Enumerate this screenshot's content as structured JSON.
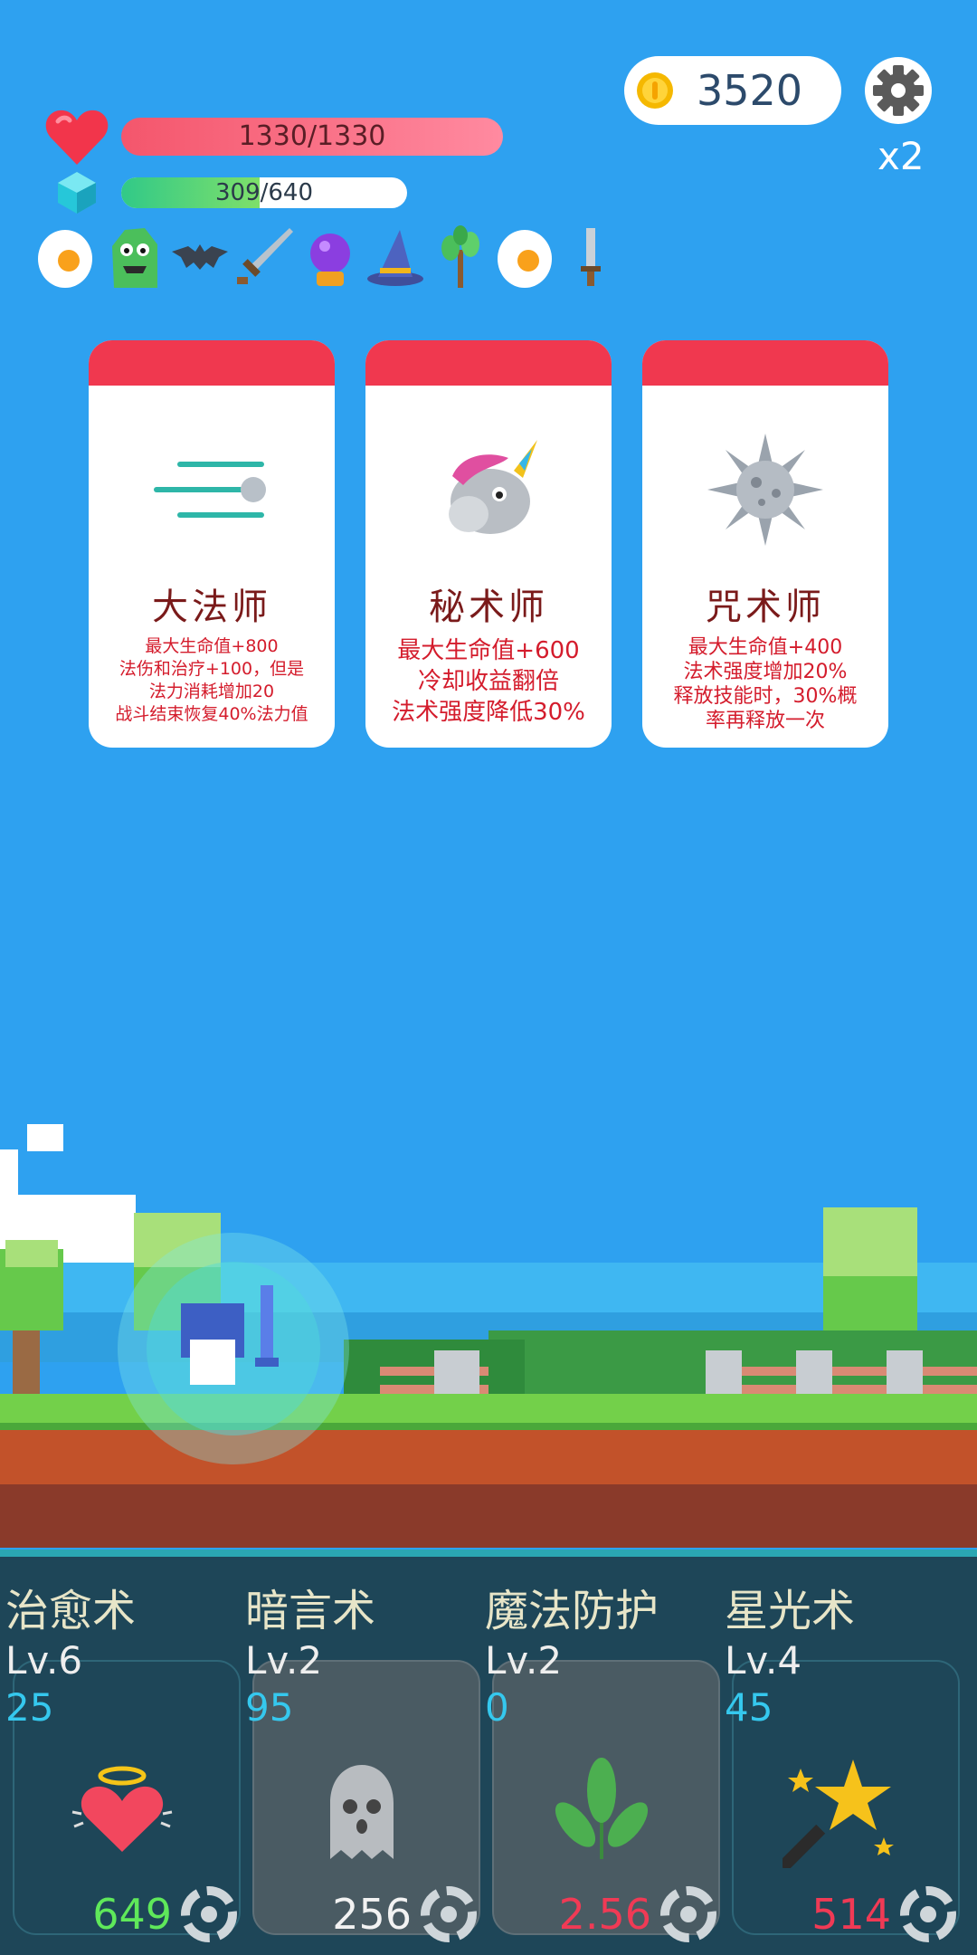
{
  "hud": {
    "coins": "3520",
    "speed": "x2",
    "hp": {
      "text": "1330/1330",
      "current": 1330,
      "max": 1330
    },
    "mp": {
      "text": "309/640",
      "current": 309,
      "max": 640
    },
    "items": [
      "fried-egg-icon",
      "green-monster-icon",
      "bat-icon",
      "sword-icon",
      "crystal-ball-icon",
      "wizard-hat-icon",
      "sapling-icon",
      "fried-egg-icon",
      "dagger-icon"
    ]
  },
  "cards": [
    {
      "title": "大法师",
      "icon": "speed-lines-icon",
      "lines": [
        "最大生命值+800",
        "法伤和治疗+100，但是",
        "法力消耗增加20",
        "战斗结束恢复40%法力值"
      ]
    },
    {
      "title": "秘术师",
      "icon": "unicorn-icon",
      "lines": [
        "最大生命值+600",
        "冷却收益翻倍",
        "法术强度降低30%"
      ]
    },
    {
      "title": "咒术师",
      "icon": "spiked-ball-icon",
      "lines": [
        "最大生命值+400",
        "法术强度增加20%",
        "释放技能时，30%概",
        "率再释放一次"
      ]
    }
  ],
  "skills": [
    {
      "name": "治愈术",
      "level": "Lv.6",
      "cost": "25",
      "value": "649",
      "value_color": "#5fe85a",
      "icon": "halo-heart-icon",
      "dim": false
    },
    {
      "name": "暗言术",
      "level": "Lv.2",
      "cost": "95",
      "value": "256",
      "value_color": "#f2f2f2",
      "icon": "ghost-icon",
      "dim": true
    },
    {
      "name": "魔法防护",
      "level": "Lv.2",
      "cost": "0",
      "value": "2.56",
      "value_color": "#f03a55",
      "icon": "leaf-icon",
      "dim": true
    },
    {
      "name": "星光术",
      "level": "Lv.4",
      "cost": "45",
      "value": "514",
      "value_color": "#f03a55",
      "icon": "star-wand-icon",
      "dim": false
    }
  ],
  "colors": {
    "sky": "#2ea1f0",
    "card_header": "#f0384f",
    "panel": "#1e4658"
  }
}
